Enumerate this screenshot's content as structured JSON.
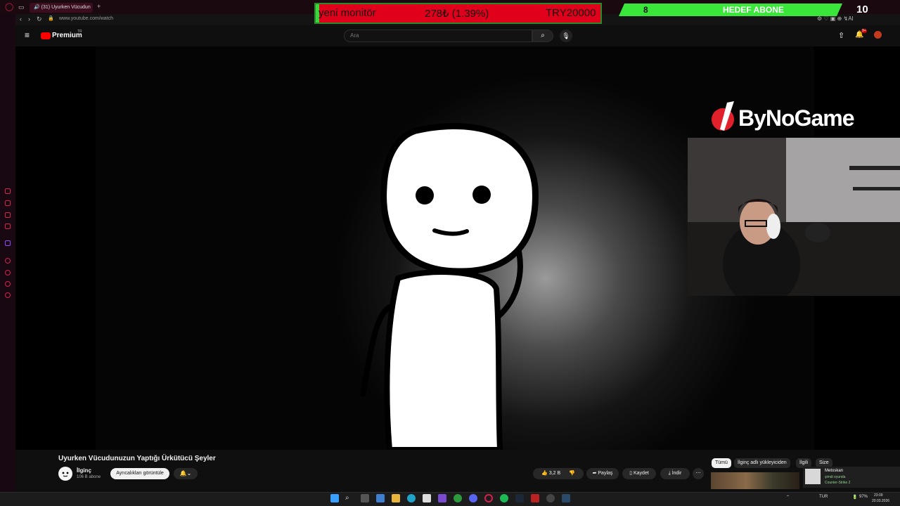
{
  "browser": {
    "tab_title": "(31) Uyurken Vücudun",
    "url": "www.youtube.com/watch",
    "accent": "#d6204a"
  },
  "youtube": {
    "logo_text": "Premium",
    "logo_sup": "TR",
    "search_placeholder": "Ara",
    "notif_count": "9+",
    "title": "Uyurken Vücudunuzun Yaptığı Ürkütücü Şeyler",
    "channel": "İlginç",
    "subscribers": "106 B abone",
    "join_label": "Ayrıcalıkları görüntüle",
    "likes": "3,2 B",
    "share_label": "Paylaş",
    "save_label": "Kaydet",
    "download_label": "İndir",
    "more_label": "⋯",
    "chips": [
      "Tümü",
      "İlginç adlı yükleyiciden",
      "İlgili",
      "Size"
    ]
  },
  "overlay": {
    "goal_item": "yeni monitör",
    "goal_progress": "278₺ (1.39%)",
    "goal_target": "TRY20000",
    "goal_fraction": 0.0139,
    "sub_current": "8",
    "sub_label": "HEDEF ABONE",
    "sub_goal": "10",
    "brand": "ByNoGame"
  },
  "notification": {
    "name": "Metoskan",
    "status": "şimdi oyunda",
    "game": "Counter-Strike 2"
  },
  "taskbar": {
    "lang": "TUR",
    "battery": "97%",
    "time": "23:09",
    "date": "20.03.2026"
  }
}
